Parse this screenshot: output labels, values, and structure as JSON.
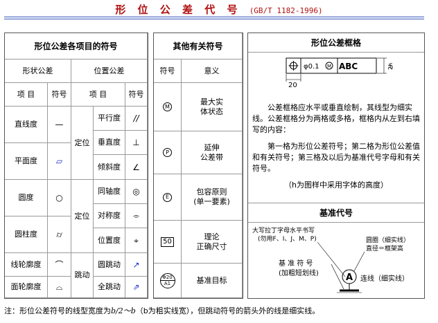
{
  "title": {
    "main": "形 位 公 差 代 号",
    "std": "(GB/T 1182-1996)"
  },
  "left_panel": {
    "header": "形位公差各项目的符号",
    "group_form": "形状公差",
    "group_position": "位置公差",
    "col_item": "项 目",
    "col_sym": "符号",
    "col_item2": "项 目",
    "col_sym2": "符号",
    "form_items": [
      {
        "name": "直线度",
        "symbol": "—"
      },
      {
        "name": "平面度",
        "symbol": "▱"
      },
      {
        "name": "圆度",
        "symbol": "○"
      },
      {
        "name": "圆柱度",
        "symbol": "⌭"
      },
      {
        "name": "线轮廓度",
        "symbol": "⌒"
      },
      {
        "name": "面轮廓度",
        "symbol": "⌓"
      }
    ],
    "orient_group": "定位",
    "locate_group": "定位",
    "runout_group": "跳动",
    "position_items": [
      {
        "name": "平行度",
        "symbol": "//"
      },
      {
        "name": "垂直度",
        "symbol": "⊥"
      },
      {
        "name": "倾斜度",
        "symbol": "∠"
      },
      {
        "name": "同轴度",
        "symbol": "◎"
      },
      {
        "name": "对称度",
        "symbol": "⌯"
      },
      {
        "name": "位置度",
        "symbol": "⌖"
      },
      {
        "name": "圆跳动",
        "symbol": "↗"
      },
      {
        "name": "全跳动",
        "symbol": "⇗"
      }
    ]
  },
  "middle_panel": {
    "header": "其他有关符号",
    "col_sym": "符号",
    "col_meaning": "意义",
    "rows": [
      {
        "symbol": "M",
        "meaning_1": "最大实",
        "meaning_2": "体状态"
      },
      {
        "symbol": "P",
        "meaning_1": "延伸",
        "meaning_2": "公差带"
      },
      {
        "symbol": "E",
        "meaning_1": "包容原则",
        "meaning_2": "(单一要素)"
      },
      {
        "symbol": "50",
        "meaning_1": "理论",
        "meaning_2": "正确尺寸"
      },
      {
        "symbol_top": "Φ20",
        "symbol_bottom": "A1",
        "meaning_1": "基准目标",
        "meaning_2": ""
      }
    ]
  },
  "right_panel": {
    "header": "形位公差框格",
    "frame_value": "φ0.1",
    "frame_datum": "ABC",
    "frame_dim": "20",
    "frame_h": "2h",
    "frame_h2": "h",
    "paragraph_1": "公差框格应水平或垂直绘制，其线型为细实线。公差框格分为两格或多格，框格内从左到右填写的内容：",
    "paragraph_2": "第一格为形位公差符号；第二格为形位公差值和有关符号；第三格及以后为基准代号字母和有关符号。",
    "paragraph_3": "（h为图样中采用字体的高度）",
    "datum_header": "基准代号",
    "datum_letter": "A",
    "datum_note_1": "大写拉丁字母水平书写",
    "datum_note_2": "(勿用F、I、J、M、P)",
    "datum_circle_1": "圆圈（细实线）",
    "datum_circle_2": "直径＝框架高",
    "datum_sym_1": "基 准 符 号",
    "datum_sym_2": "(加粗短划线)",
    "datum_line": "连线（细实线）"
  },
  "footnote": {
    "pre": "注：形位公差符号的线型宽度为",
    "expr": "b/2～b",
    "mid": "（b为粗实线宽），但跳动符号的箭头外的线是细实线。"
  }
}
